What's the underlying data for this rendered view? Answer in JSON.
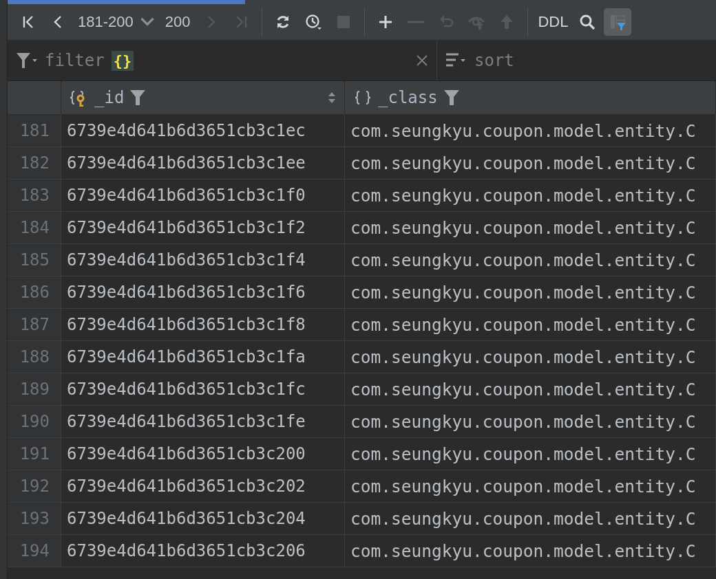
{
  "toolbar": {
    "page_range": "181-200",
    "total": "200",
    "buttons": [
      {
        "kind": "first",
        "disabled": false
      },
      {
        "kind": "prev",
        "disabled": false
      },
      {
        "kind": "range",
        "disabled": false
      },
      {
        "kind": "next",
        "disabled": true
      },
      {
        "kind": "last",
        "disabled": true
      },
      {
        "kind": "separator"
      },
      {
        "kind": "reload",
        "disabled": false
      },
      {
        "kind": "history",
        "disabled": false
      },
      {
        "kind": "stop",
        "disabled": true
      },
      {
        "kind": "separator"
      },
      {
        "kind": "add",
        "disabled": false
      },
      {
        "kind": "remove",
        "disabled": true
      },
      {
        "kind": "revert",
        "disabled": true
      },
      {
        "kind": "preview",
        "disabled": true
      },
      {
        "kind": "submit",
        "disabled": true
      },
      {
        "kind": "separator"
      },
      {
        "kind": "ddl",
        "disabled": false
      },
      {
        "kind": "search",
        "disabled": false
      },
      {
        "kind": "panel",
        "selected": true
      }
    ],
    "ddl_label": "DDL"
  },
  "filter": {
    "placeholder": "filter",
    "badge": "{}"
  },
  "sort": {
    "placeholder": "sort"
  },
  "table": {
    "columns": [
      {
        "name": "_id",
        "kind": "key"
      },
      {
        "name": "_class",
        "kind": "object"
      }
    ],
    "rows": [
      {
        "num": "181",
        "id": "6739e4d641b6d3651cb3c1ec",
        "class": "com.seungkyu.coupon.model.entity.C"
      },
      {
        "num": "182",
        "id": "6739e4d641b6d3651cb3c1ee",
        "class": "com.seungkyu.coupon.model.entity.C"
      },
      {
        "num": "183",
        "id": "6739e4d641b6d3651cb3c1f0",
        "class": "com.seungkyu.coupon.model.entity.C"
      },
      {
        "num": "184",
        "id": "6739e4d641b6d3651cb3c1f2",
        "class": "com.seungkyu.coupon.model.entity.C"
      },
      {
        "num": "185",
        "id": "6739e4d641b6d3651cb3c1f4",
        "class": "com.seungkyu.coupon.model.entity.C"
      },
      {
        "num": "186",
        "id": "6739e4d641b6d3651cb3c1f6",
        "class": "com.seungkyu.coupon.model.entity.C"
      },
      {
        "num": "187",
        "id": "6739e4d641b6d3651cb3c1f8",
        "class": "com.seungkyu.coupon.model.entity.C"
      },
      {
        "num": "188",
        "id": "6739e4d641b6d3651cb3c1fa",
        "class": "com.seungkyu.coupon.model.entity.C"
      },
      {
        "num": "189",
        "id": "6739e4d641b6d3651cb3c1fc",
        "class": "com.seungkyu.coupon.model.entity.C"
      },
      {
        "num": "190",
        "id": "6739e4d641b6d3651cb3c1fe",
        "class": "com.seungkyu.coupon.model.entity.C"
      },
      {
        "num": "191",
        "id": "6739e4d641b6d3651cb3c200",
        "class": "com.seungkyu.coupon.model.entity.C"
      },
      {
        "num": "192",
        "id": "6739e4d641b6d3651cb3c202",
        "class": "com.seungkyu.coupon.model.entity.C"
      },
      {
        "num": "193",
        "id": "6739e4d641b6d3651cb3c204",
        "class": "com.seungkyu.coupon.model.entity.C"
      },
      {
        "num": "194",
        "id": "6739e4d641b6d3651cb3c206",
        "class": "com.seungkyu.coupon.model.entity.C"
      }
    ]
  }
}
